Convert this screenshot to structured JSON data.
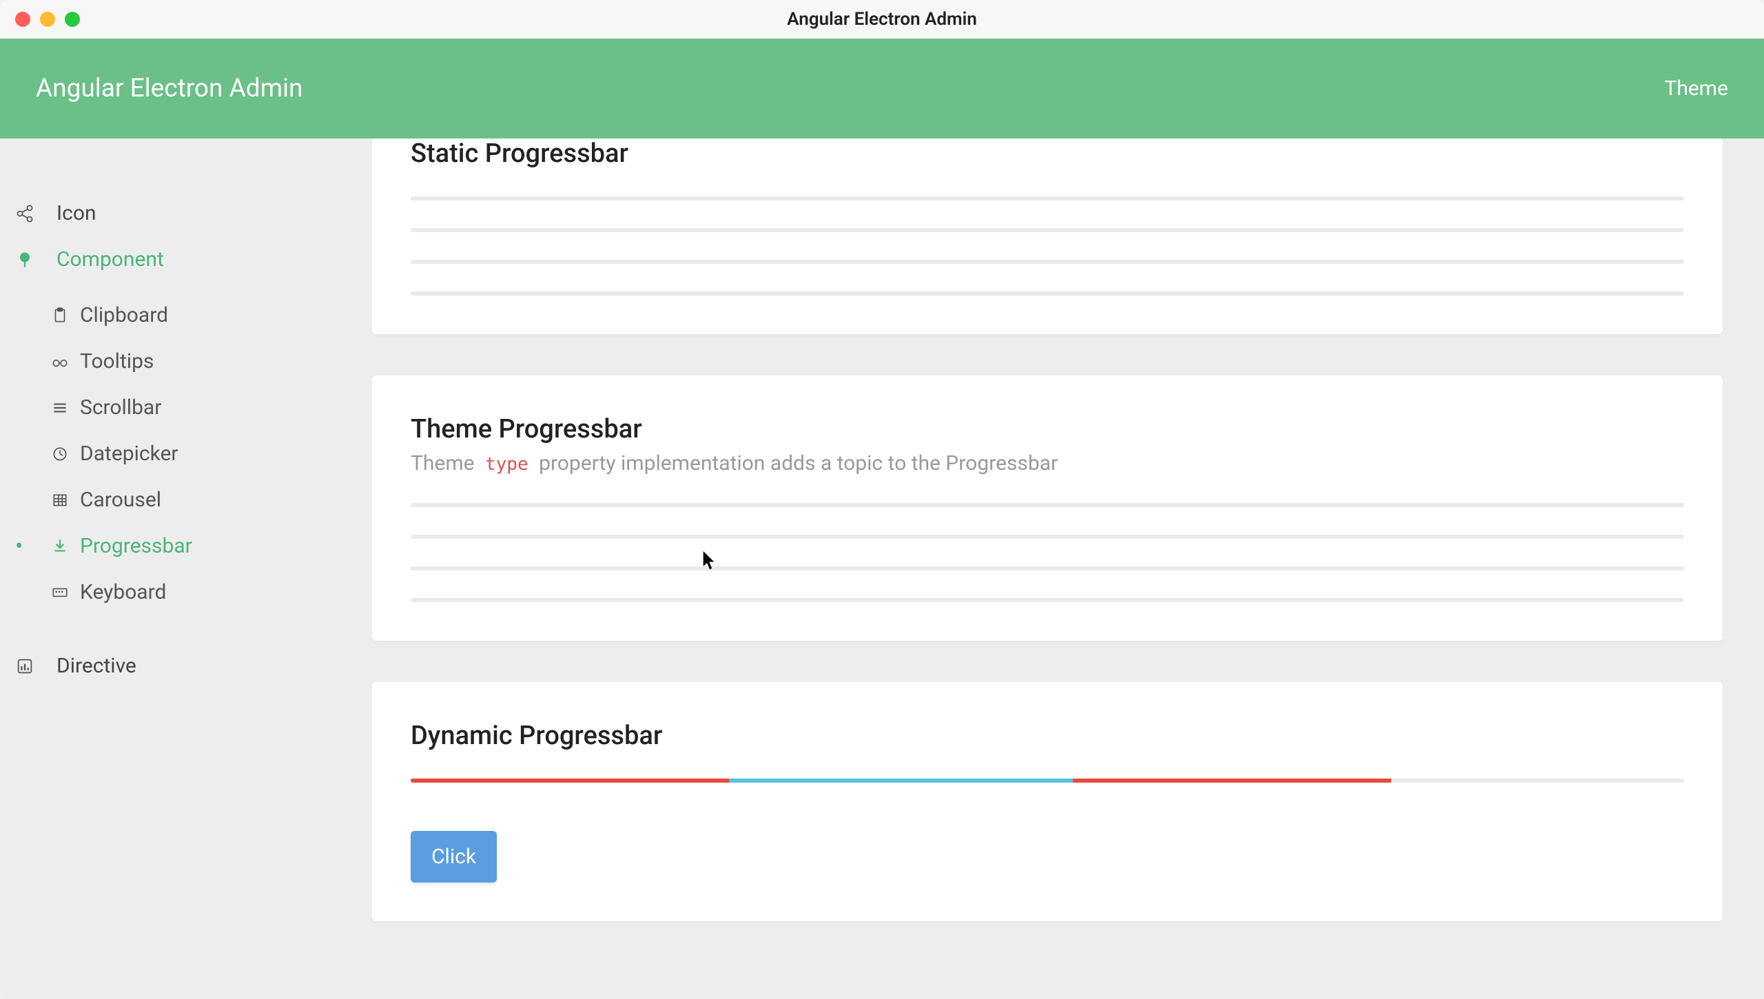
{
  "window": {
    "title": "Angular Electron Admin"
  },
  "header": {
    "app_title": "Angular Electron Admin",
    "theme_link": "Theme"
  },
  "sidebar": {
    "icon_label": "Icon",
    "component_label": "Component",
    "directive_label": "Directive",
    "subs": {
      "clipboard": "Clipboard",
      "tooltips": "Tooltips",
      "scrollbar": "Scrollbar",
      "datepicker": "Datepicker",
      "carousel": "Carousel",
      "progressbar": "Progressbar",
      "keyboard": "Keyboard"
    }
  },
  "cards": {
    "static": {
      "title": "Static Progressbar"
    },
    "theme": {
      "title": "Theme Progressbar",
      "desc_pre": "Theme ",
      "desc_code": "type",
      "desc_post": " property implementation adds a topic to the Progressbar"
    },
    "dynamic": {
      "title": "Dynamic Progressbar",
      "button": "Click"
    }
  }
}
